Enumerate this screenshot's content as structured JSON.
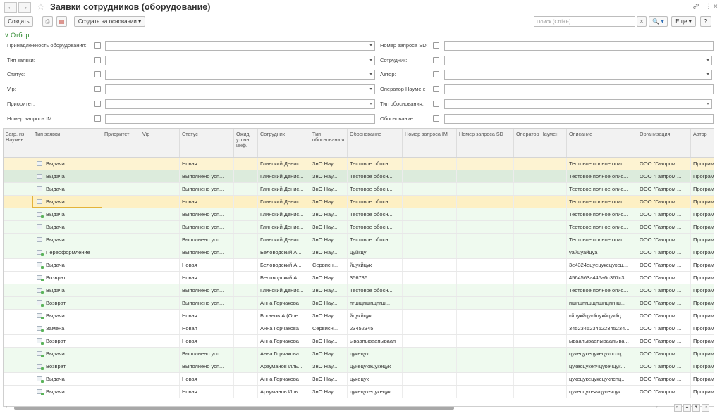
{
  "window": {
    "title": "Заявки сотрудников (оборудование)",
    "back_icon": "←",
    "forward_icon": "→",
    "star_icon": "☆",
    "link_icon": "🔗",
    "more_icon": "⋮",
    "close_icon": "×"
  },
  "toolbar": {
    "create_label": "Создать",
    "print_icon": "⎙",
    "report_icon": "▤",
    "create_based_label": "Создать на основании ▾",
    "search_placeholder": "Поиск (Ctrl+F)",
    "search_clear": "×",
    "search_btn": "🔍 ▾",
    "more_label": "Еще ▾",
    "help_label": "?"
  },
  "filter": {
    "header": "∨ Отбор",
    "left": [
      {
        "label": "Принадлежность оборудования:",
        "dropdown": true
      },
      {
        "label": "Тип заявки:",
        "dropdown": true
      },
      {
        "label": "Статус:",
        "dropdown": true
      },
      {
        "label": "Vip:",
        "dropdown": true
      },
      {
        "label": "Приоритет:",
        "dropdown": true
      },
      {
        "label": "Номер запроса IM:",
        "dropdown": false
      }
    ],
    "right": [
      {
        "label": "Номер запроса SD:",
        "dropdown": false
      },
      {
        "label": "Сотрудник:",
        "dropdown": true
      },
      {
        "label": "Автор:",
        "dropdown": true
      },
      {
        "label": "Оператор Наумен:",
        "dropdown": false
      },
      {
        "label": "Тип обоснования:",
        "dropdown": true
      },
      {
        "label": "Обоснование:",
        "dropdown": false
      }
    ],
    "dropdown_arrow": "▾"
  },
  "table": {
    "columns": [
      "Загр. из Наумен",
      "Тип заявки",
      "Приоритет",
      "Vip",
      "Статус",
      "Ожид. уточн. инф.",
      "Сотрудник",
      "Тип обосновани я",
      "Обоснование",
      "Номер запроса IM",
      "Номер запроса SD",
      "Оператор Наумен",
      "Описание",
      "Организация",
      "Автор"
    ],
    "rows": [
      {
        "type": "Выдача",
        "status": "Новая",
        "employee": "Глинский Денис...",
        "reason_type": "ЗнО Нау...",
        "reason": "Тестовое обосн...",
        "desc": "Тестовое полное опис...",
        "org": "ООО \"Газпром ...",
        "author": "Програм",
        "done": false,
        "bg": "#fdf3d2"
      },
      {
        "type": "Выдача",
        "status": "Выполнено усп...",
        "employee": "Глинский Денис...",
        "reason_type": "ЗнО Нау...",
        "reason": "Тестовое обосн...",
        "desc": "Тестовое полное опис...",
        "org": "ООО \"Газпром ...",
        "author": "Програм",
        "done": false,
        "bg": "#dcebdc"
      },
      {
        "type": "Выдача",
        "status": "Выполнено усп...",
        "employee": "Глинский Денис...",
        "reason_type": "ЗнО Нау...",
        "reason": "Тестовое обосн...",
        "desc": "Тестовое полное опис...",
        "org": "ООО \"Газпром ...",
        "author": "Програм",
        "done": false,
        "bg": "#effaef"
      },
      {
        "type": "Выдача",
        "status": "Новая",
        "employee": "Глинский Денис...",
        "reason_type": "ЗнО Нау...",
        "reason": "Тестовое обосн...",
        "desc": "Тестовое полное опис...",
        "org": "ООО \"Газпром ...",
        "author": "Програм",
        "done": false,
        "bg": "#fdf0c4"
      },
      {
        "type": "Выдача",
        "status": "Выполнено усп...",
        "employee": "Глинский Денис...",
        "reason_type": "ЗнО Нау...",
        "reason": "Тестовое обосн...",
        "desc": "Тестовое полное опис...",
        "org": "ООО \"Газпром ...",
        "author": "Програм",
        "done": true,
        "bg": "#effaef"
      },
      {
        "type": "Выдача",
        "status": "Выполнено усп...",
        "employee": "Глинский Денис...",
        "reason_type": "ЗнО Нау...",
        "reason": "Тестовое обосн...",
        "desc": "Тестовое полное опис...",
        "org": "ООО \"Газпром ...",
        "author": "Програм",
        "done": false,
        "bg": "#effaef"
      },
      {
        "type": "Выдача",
        "status": "Выполнено усп...",
        "employee": "Глинский Денис...",
        "reason_type": "ЗнО Нау...",
        "reason": "Тестовое обосн...",
        "desc": "Тестовое полное опис...",
        "org": "ООО \"Газпром ...",
        "author": "Програм",
        "done": false,
        "bg": "#effaef"
      },
      {
        "type": "Переоформление",
        "status": "Выполнено усп...",
        "employee": "Беловодский А...",
        "reason_type": "ЗнО Нау...",
        "reason": "цуйкцу",
        "desc": "уайцуайцуа",
        "org": "ООО \"Газпром ...",
        "author": "Програм",
        "done": true,
        "bg": "#effaef"
      },
      {
        "type": "Выдача",
        "status": "Новая",
        "employee": "Беловодский А...",
        "reason_type": "Сервисн...",
        "reason": "йцукйцук",
        "desc": "3е4324ецуецукецукец...",
        "org": "ООО \"Газпром ...",
        "author": "Програм",
        "done": true,
        "bg": "#ffffff"
      },
      {
        "type": "Возврат",
        "status": "Новая",
        "employee": "Беловодский А...",
        "reason_type": "ЗнО Нау...",
        "reason": "356736",
        "desc": "4564563а445а6с367с3...",
        "org": "ООО \"Газпром ...",
        "author": "Програм",
        "done": true,
        "bg": "#ffffff"
      },
      {
        "type": "Выдача",
        "status": "Выполнено усп...",
        "employee": "Глинский Денис...",
        "reason_type": "ЗнО Нау...",
        "reason": "Тестовое обосн...",
        "desc": "Тестовое полное опис...",
        "org": "ООО \"Газпром ...",
        "author": "Програм",
        "done": true,
        "bg": "#effaef"
      },
      {
        "type": "Возврат",
        "status": "Выполнено усп...",
        "employee": "Анна Горчакова",
        "reason_type": "ЗнО Нау...",
        "reason": "пгшщпшгщпгш...",
        "desc": "пшгщпгшщпшгщпгнш...",
        "org": "ООО \"Газпром ...",
        "author": "Програм",
        "done": true,
        "bg": "#effaef"
      },
      {
        "type": "Выдача",
        "status": "Новая",
        "employee": "Боганов А.(Опе...",
        "reason_type": "ЗнО Нау...",
        "reason": "йцукйцук",
        "desc": "кйцукйцукйцукйцукйц...",
        "org": "ООО \"Газпром ...",
        "author": "Програм",
        "done": true,
        "bg": "#ffffff"
      },
      {
        "type": "Замена",
        "status": "Новая",
        "employee": "Анна Горчакова",
        "reason_type": "Сервисн...",
        "reason": "23452345",
        "desc": "3452345234522345234...",
        "org": "ООО \"Газпром ...",
        "author": "Програм",
        "done": true,
        "bg": "#ffffff"
      },
      {
        "type": "Возврат",
        "status": "Новая",
        "employee": "Анна Горчакова",
        "reason_type": "ЗнО Нау...",
        "reason": "ываапываапываап",
        "desc": "ываапываапываапыва...",
        "org": "ООО \"Газпром ...",
        "author": "Програм",
        "done": true,
        "bg": "#ffffff"
      },
      {
        "type": "Выдача",
        "status": "Выполнено усп...",
        "employee": "Анна Горчакова",
        "reason_type": "ЗнО Нау...",
        "reason": "цукецук",
        "desc": "цукецукецукецукпспц...",
        "org": "ООО \"Газпром ...",
        "author": "Програм",
        "done": true,
        "bg": "#effaef"
      },
      {
        "type": "Возврат",
        "status": "Выполнено усп...",
        "employee": "Арзуманов Иль...",
        "reason_type": "ЗнО Нау...",
        "reason": "цукецукецукецук",
        "desc": "цукесцукеячцукечцук...",
        "org": "ООО \"Газпром ...",
        "author": "Програм",
        "done": true,
        "bg": "#effaef"
      },
      {
        "type": "Выдача",
        "status": "Новая",
        "employee": "Анна Горчакова",
        "reason_type": "ЗнО Нау...",
        "reason": "цукецук",
        "desc": "цукецукецукецукпспц...",
        "org": "ООО \"Газпром ...",
        "author": "Програм",
        "done": true,
        "bg": "#ffffff"
      },
      {
        "type": "Выдача",
        "status": "Новая",
        "employee": "Арзуманов Иль...",
        "reason_type": "ЗнО Нау...",
        "reason": "цукецукецукецук",
        "desc": "цукесцукеячцукечцук...",
        "org": "ООО \"Газпром ...",
        "author": "Програм",
        "done": true,
        "bg": "#ffffff"
      }
    ],
    "selected_row": 3
  },
  "pager": {
    "first": "⇤",
    "prev": "▲",
    "next": "▼",
    "last": "⇥"
  }
}
